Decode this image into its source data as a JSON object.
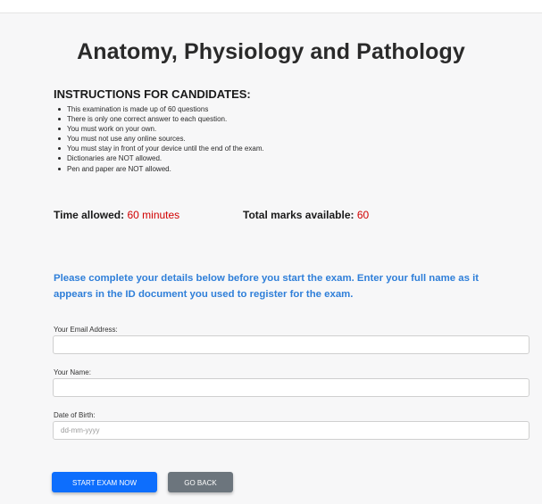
{
  "exam": {
    "title": "Anatomy, Physiology and Pathology"
  },
  "instructions": {
    "heading": "INSTRUCTIONS FOR CANDIDATES:",
    "items": [
      "This examination is made up of 60 questions",
      "There is only one correct answer to each question.",
      "You must work on your own.",
      "You must not use any online sources.",
      "You must stay in front of your device until the end of the exam.",
      "Dictionaries are NOT allowed.",
      "Pen and paper are NOT allowed."
    ]
  },
  "meta": {
    "time_label": "Time allowed:",
    "time_value": "60 minutes",
    "marks_label": "Total marks available:",
    "marks_value": "60"
  },
  "notice": "Please complete your details below before you start the exam. Enter your full name as it appears in the ID document you used to register for the exam.",
  "form": {
    "email": {
      "label": "Your Email Address:",
      "value": "",
      "placeholder": ""
    },
    "name": {
      "label": "Your Name:",
      "value": "",
      "placeholder": ""
    },
    "dob": {
      "label": "Date of Birth:",
      "value": "",
      "placeholder": "dd-mm-yyyy"
    }
  },
  "buttons": {
    "start": "START EXAM NOW",
    "back": "GO BACK"
  },
  "colors": {
    "accent_blue": "#0d6efd",
    "notice_blue": "#2f7fd9",
    "value_red": "#d10000",
    "secondary_gray": "#6c757d"
  }
}
